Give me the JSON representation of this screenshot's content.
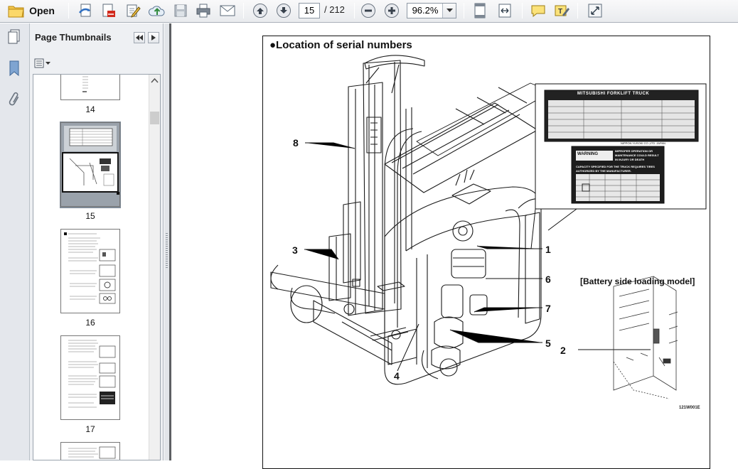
{
  "toolbar": {
    "open_label": "Open",
    "current_page": "15",
    "page_total": "/ 212",
    "zoom": "96.2%"
  },
  "thumbnail_panel": {
    "title": "Page Thumbnails",
    "pages": [
      {
        "number": "14"
      },
      {
        "number": "15",
        "selected": true
      },
      {
        "number": "16"
      },
      {
        "number": "17"
      }
    ]
  },
  "document": {
    "title": "●Location of serial numbers",
    "callouts": [
      "8",
      "3",
      "1",
      "6",
      "7",
      "5",
      "2",
      "4"
    ],
    "battery_label": "[Battery side loading model]",
    "figure_code": "121W001E",
    "nameplate": {
      "brand": "MITSUBISHI FORKLIFT TRUCK",
      "maker": "NIPPON YUSOKI CO.,LTD.  JAPAN"
    },
    "warning_plate": {
      "heading": "WARNING",
      "line1": "IMPROPER OPERATION OR",
      "line2": "MAINTENANCE COULD RESULT",
      "line3": "IN INJURY OR DEATH",
      "capacity": "CAPACITY SPECIFIED FOR THE TRUCK REQUIRES TIRES",
      "authorized": "AUTHORIZED BY THE MANUFACTURER."
    }
  },
  "colors": {
    "toolbar_bg": "#eceef1",
    "panel_bg": "#eef0f3",
    "doc_bg": "#5e6063",
    "selection": "#7f8a96"
  }
}
